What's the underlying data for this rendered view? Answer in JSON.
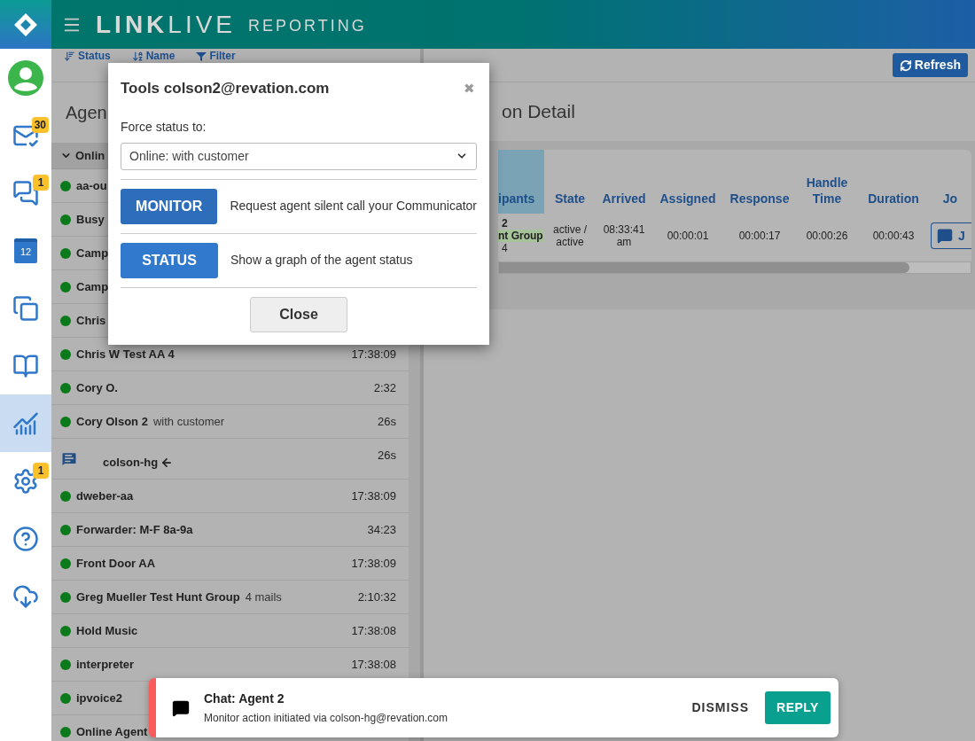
{
  "header": {
    "brand_strong": "LINK",
    "brand_light": "LIVE",
    "product": "REPORTING"
  },
  "nav": [
    {
      "selected": false
    },
    {
      "selected": false,
      "badge": "30"
    },
    {
      "selected": false,
      "badge": "1"
    },
    {
      "selected": false,
      "day": "12"
    },
    {
      "selected": false
    },
    {
      "selected": false
    },
    {
      "selected": true
    },
    {
      "selected": false,
      "badge": "1"
    },
    {
      "selected": false
    },
    {
      "selected": false
    }
  ],
  "toolbar": [
    "Status",
    "Name",
    "Filter"
  ],
  "agents_panel": {
    "title": "Agen",
    "group": "Onlin",
    "expanded": true,
    "rows": [
      {
        "kind": "agent",
        "name": "aa-ou"
      },
      {
        "kind": "agent",
        "name": "Busy"
      },
      {
        "kind": "agent",
        "name": "Camp"
      },
      {
        "kind": "agent",
        "name": "Camp"
      },
      {
        "kind": "agent",
        "name": "Chris"
      },
      {
        "kind": "agent",
        "name": "Chris W Test AA 4",
        "time": "17:38:09"
      },
      {
        "kind": "agent",
        "name": "Cory O.",
        "time": "2:32"
      },
      {
        "kind": "agent",
        "name": "Cory Olson 2",
        "note": "with customer",
        "time": "26s"
      },
      {
        "kind": "session",
        "name": "colson-hg",
        "time": "26s"
      },
      {
        "kind": "agent",
        "name": "dweber-aa",
        "time": "17:38:09"
      },
      {
        "kind": "agent",
        "name": "Forwarder: M-F 8a-9a",
        "time": "34:23"
      },
      {
        "kind": "agent",
        "name": "Front Door AA",
        "time": "17:38:09"
      },
      {
        "kind": "agent",
        "name": "Greg Mueller Test Hunt Group",
        "note": "4 mails",
        "time": "2:10:32"
      },
      {
        "kind": "agent",
        "name": "Hold Music",
        "time": "17:38:08"
      },
      {
        "kind": "agent",
        "name": "interpreter",
        "time": "17:38:08"
      },
      {
        "kind": "agent",
        "name": "ipvoice2"
      },
      {
        "kind": "agent",
        "name": "Online Agent"
      }
    ]
  },
  "detail": {
    "refresh": "Refresh",
    "title": "on Detail",
    "columns": [
      "ipants",
      "State",
      "Arrived",
      "Assigned",
      "Response",
      "Handle Time",
      "Duration",
      "Jo"
    ],
    "row": {
      "participants": [
        "2",
        "nt Group",
        "4"
      ],
      "state": "active / active",
      "arrived": "08:33:41 am",
      "assigned": "00:00:01",
      "response": "00:00:17",
      "handle_time": "00:00:26",
      "duration": "00:00:43",
      "join": "J"
    }
  },
  "modal": {
    "title": "Tools colson2@revation.com",
    "close_glyph": "✖",
    "force_label": "Force status to:",
    "force_value": "Online: with customer",
    "actions": [
      {
        "label": "MONITOR",
        "description": "Request agent silent call your Communicator",
        "pressed": true
      },
      {
        "label": "STATUS",
        "description": "Show a graph of the agent status",
        "pressed": false
      }
    ],
    "close": "Close"
  },
  "toast": {
    "title": "Chat: Agent 2",
    "message": "Monitor action initiated via colson-hg@revation.com",
    "dismiss": "DISMISS",
    "reply": "REPLY"
  }
}
